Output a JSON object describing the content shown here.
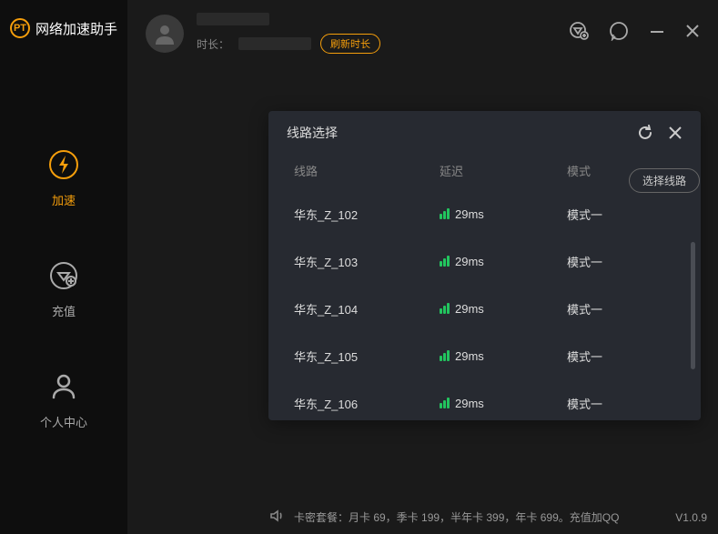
{
  "app": {
    "title": "网络加速助手"
  },
  "nav": {
    "boost": "加速",
    "recharge": "充值",
    "profile": "个人中心"
  },
  "topbar": {
    "duration_label": "时长：",
    "refresh_btn": "刷新时长"
  },
  "select_route_btn": "选择线路",
  "modal": {
    "title": "线路选择",
    "cols": {
      "route": "线路",
      "latency": "延迟",
      "mode": "模式"
    },
    "rows": [
      {
        "route": "华东_Z_102",
        "latency": "29ms",
        "mode": "模式一"
      },
      {
        "route": "华东_Z_103",
        "latency": "29ms",
        "mode": "模式一"
      },
      {
        "route": "华东_Z_104",
        "latency": "29ms",
        "mode": "模式一"
      },
      {
        "route": "华东_Z_105",
        "latency": "29ms",
        "mode": "模式一"
      },
      {
        "route": "华东_Z_106",
        "latency": "29ms",
        "mode": "模式一"
      }
    ]
  },
  "footer": {
    "text": "卡密套餐：月卡 69，季卡 199，半年卡 399，年卡 699。充值加QQ",
    "version": "V1.0.9"
  }
}
